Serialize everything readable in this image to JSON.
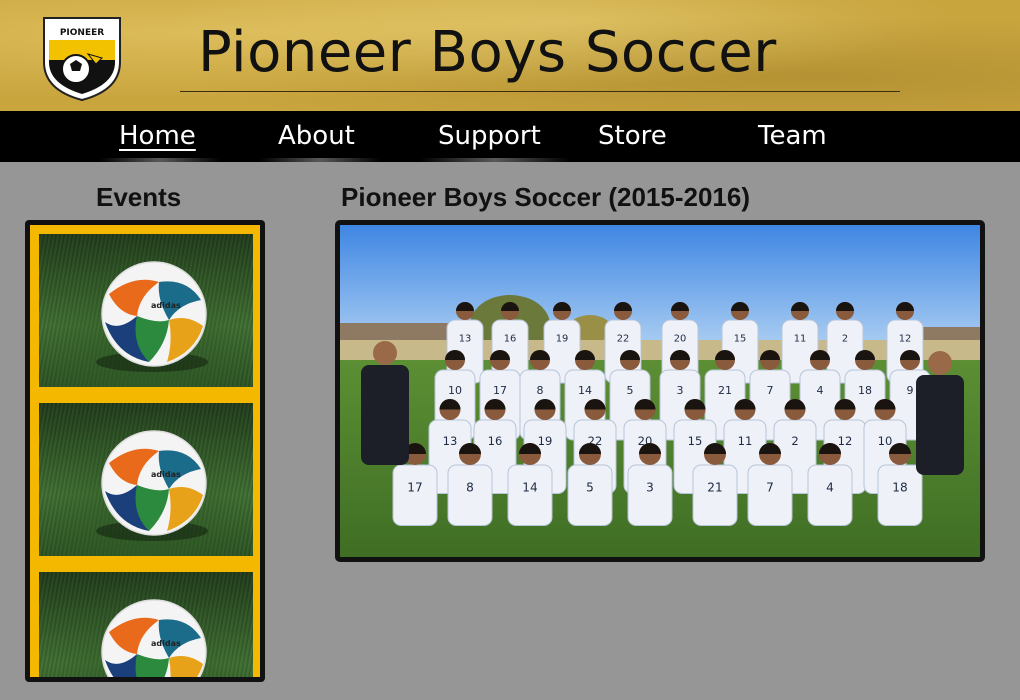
{
  "header": {
    "title": "Pioneer Boys Soccer",
    "logo_text": "PIONEER",
    "logo_icon": "pioneer-crest-icon"
  },
  "nav": {
    "items": [
      {
        "label": "Home",
        "active": true
      },
      {
        "label": "About",
        "active": false
      },
      {
        "label": "Support",
        "active": false
      },
      {
        "label": "Store",
        "active": false
      },
      {
        "label": "Team",
        "active": false
      }
    ]
  },
  "events": {
    "title": "Events",
    "cards": [
      {
        "icon": "soccer-ball-icon"
      },
      {
        "icon": "soccer-ball-icon"
      },
      {
        "icon": "soccer-ball-icon"
      }
    ]
  },
  "main": {
    "title": "Pioneer Boys Soccer (2015-2016)",
    "photo": "team-photo",
    "jersey_numbers": [
      "13",
      "16",
      "19",
      "22",
      "20",
      "15",
      "11",
      "2",
      "12",
      "10",
      "17",
      "8",
      "14",
      "5",
      "3",
      "21",
      "7",
      "4",
      "18",
      "9"
    ]
  },
  "colors": {
    "header_gold": "#c9a53e",
    "nav_black": "#000000",
    "events_border": "#f5b800",
    "page_gray": "#969696"
  }
}
